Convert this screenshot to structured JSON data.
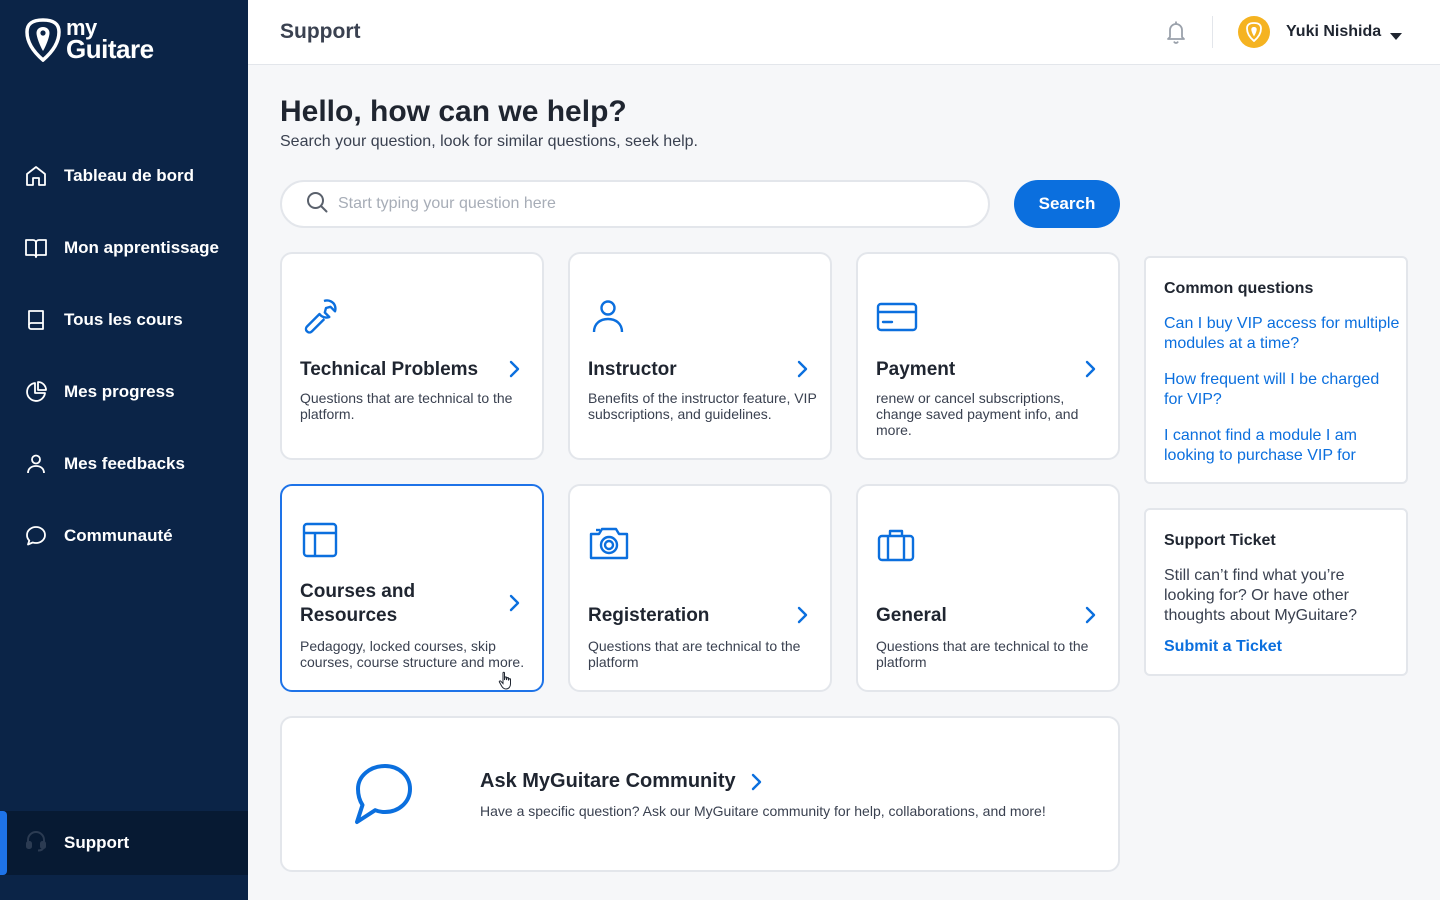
{
  "sidebar": {
    "logo": {
      "line1": "my",
      "line2": "Guitare"
    },
    "items": [
      {
        "label": "Tableau de bord",
        "icon": "home-icon"
      },
      {
        "label": "Mon apprentissage",
        "icon": "open-book-icon"
      },
      {
        "label": "Tous les cours",
        "icon": "book-icon"
      },
      {
        "label": "Mes progress",
        "icon": "pie-chart-icon"
      },
      {
        "label": "Mes feedbacks",
        "icon": "user-icon"
      },
      {
        "label": "Communauté",
        "icon": "chat-icon"
      }
    ],
    "support": {
      "label": "Support",
      "icon": "headset-icon",
      "active": true
    }
  },
  "header": {
    "title": "Support",
    "user_name": "Yuki Nishida"
  },
  "main": {
    "heading": "Hello, how can we help?",
    "subheading": "Search your question, look for similar questions, seek help.",
    "search": {
      "placeholder": "Start typing your question here",
      "value": "",
      "button_label": "Search"
    },
    "categories": [
      {
        "title": "Technical Problems",
        "desc": "Questions that are technical to the platform.",
        "icon": "wrench-icon"
      },
      {
        "title": "Instructor",
        "desc": "Benefits of the instructor feature, VIP  subscriptions, and guidelines.",
        "icon": "user-icon"
      },
      {
        "title": "Payment",
        "desc": "renew or cancel subscriptions, change saved payment info, and more.",
        "icon": "credit-card-icon"
      },
      {
        "title": "Courses and Resources",
        "desc": "Pedagogy, locked courses, skip courses, course structure and more.",
        "icon": "layout-icon",
        "active": true
      },
      {
        "title": "Registeration",
        "desc": "Questions that are technical to the platform",
        "icon": "camera-icon"
      },
      {
        "title": "General",
        "desc": "Questions that are technical to the platform",
        "icon": "briefcase-icon"
      }
    ],
    "community": {
      "title": "Ask MyGuitare Community",
      "desc": "Have a specific question? Ask our MyGuitare community for help, collaborations, and more!",
      "icon": "chat-bubble-icon"
    }
  },
  "common_questions": {
    "title": "Common questions",
    "items": [
      "Can I buy VIP access for multiple modules at a time?",
      "How frequent will I be charged for VIP?",
      "I cannot find a module I am looking to purchase VIP for"
    ]
  },
  "support_ticket": {
    "title": "Support Ticket",
    "text": "Still can’t find what you’re looking for? Or have other thoughts about MyGuitare?",
    "link": "Submit a Ticket"
  },
  "colors": {
    "sidebar_bg": "#0b2447",
    "accent": "#0b6fde",
    "avatar": "#f5b321"
  }
}
